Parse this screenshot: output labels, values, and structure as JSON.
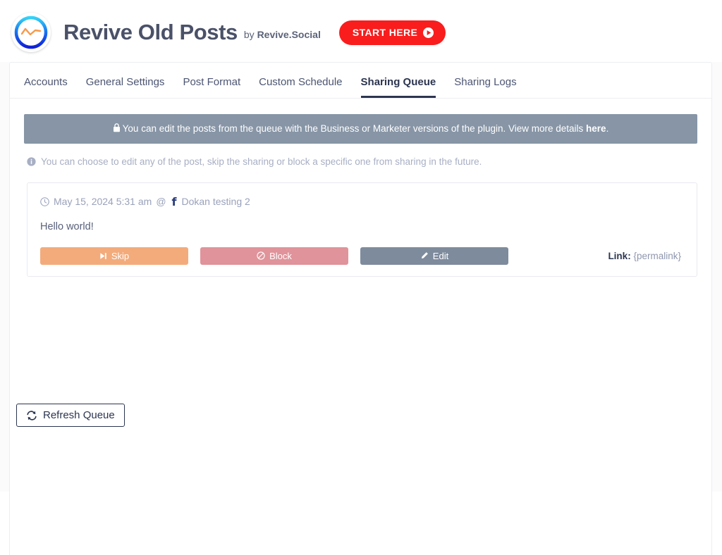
{
  "header": {
    "logo_icon": "revive-circle-wave-logo",
    "title": "Revive Old Posts",
    "by_prefix": "by ",
    "by_brand": "Revive.Social",
    "start_button": {
      "label": "START HERE",
      "icon": "play-circle-icon",
      "color": "#f91d1d"
    }
  },
  "tabs": [
    {
      "label": "Accounts",
      "active": false
    },
    {
      "label": "General Settings",
      "active": false
    },
    {
      "label": "Post Format",
      "active": false
    },
    {
      "label": "Custom Schedule",
      "active": false
    },
    {
      "label": "Sharing Queue",
      "active": true
    },
    {
      "label": "Sharing Logs",
      "active": false
    }
  ],
  "notice": {
    "icon": "lock-icon",
    "text": "You can edit the posts from the queue with the Business or Marketer versions of the plugin. View more details ",
    "link_text": "here",
    "suffix": ".",
    "background": "#8795a6"
  },
  "info_line": {
    "icon": "info-circle-icon",
    "text": "You can choose to edit any of the post, skip the sharing or block a specific one from sharing in the future."
  },
  "queue": {
    "posts": [
      {
        "clock_icon": "clock-icon",
        "datetime": "May 15, 2024 5:31 am",
        "at_symbol": "@",
        "network_icon": "facebook-icon",
        "network_glyph": "f",
        "account_name": "Dokan testing 2",
        "title": "Hello world!",
        "buttons": {
          "skip": {
            "label": "Skip",
            "icon": "step-forward-icon",
            "color": "#f3ab7b"
          },
          "block": {
            "label": "Block",
            "icon": "ban-icon",
            "color": "#e0939a"
          },
          "edit": {
            "label": "Edit",
            "icon": "pencil-icon",
            "color": "#7e8b9d"
          }
        },
        "link_label": "Link:",
        "link_value": "{permalink}"
      }
    ]
  },
  "footer": {
    "refresh_button": {
      "label": "Refresh Queue",
      "icon": "refresh-sync-icon"
    }
  }
}
